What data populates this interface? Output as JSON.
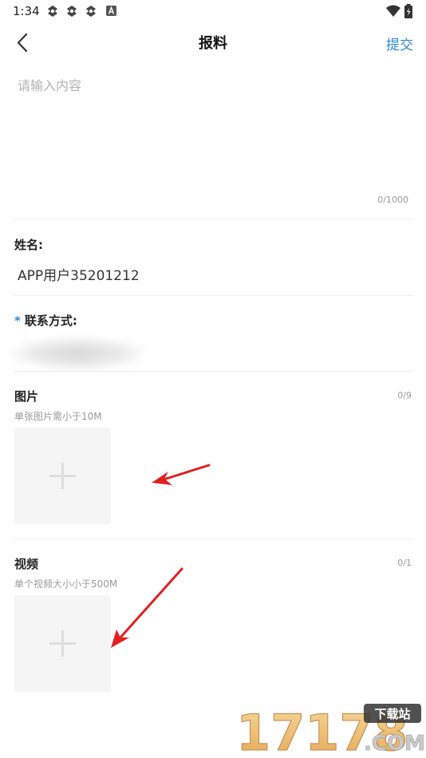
{
  "status_bar": {
    "time": "1:34",
    "left_icons": [
      "notification-icon",
      "notification-icon",
      "notification-icon",
      "app-a-icon"
    ],
    "right_icons": [
      "wifi-icon",
      "battery-icon"
    ]
  },
  "nav": {
    "back_icon": "chevron-left-icon",
    "title": "报料",
    "submit_label": "提交",
    "accent_color": "#2f88d4"
  },
  "content": {
    "placeholder": "请输入内容",
    "value": "",
    "counter": "0/1000"
  },
  "name_field": {
    "label": "姓名:",
    "value": "APP用户35201212"
  },
  "contact_field": {
    "required_mark": "*",
    "label": "联系方式:"
  },
  "images": {
    "title": "图片",
    "count": "0/9",
    "hint": "单张图片需小于10M",
    "add_icon": "plus-icon"
  },
  "videos": {
    "title": "视频",
    "count": "0/1",
    "hint": "单个视频大小小于500M",
    "add_icon": "plus-icon"
  },
  "annotation": {
    "arrow_color": "#e02020"
  },
  "watermark": {
    "number": "17178",
    "badge": "下载站",
    "domain": ".COM"
  }
}
